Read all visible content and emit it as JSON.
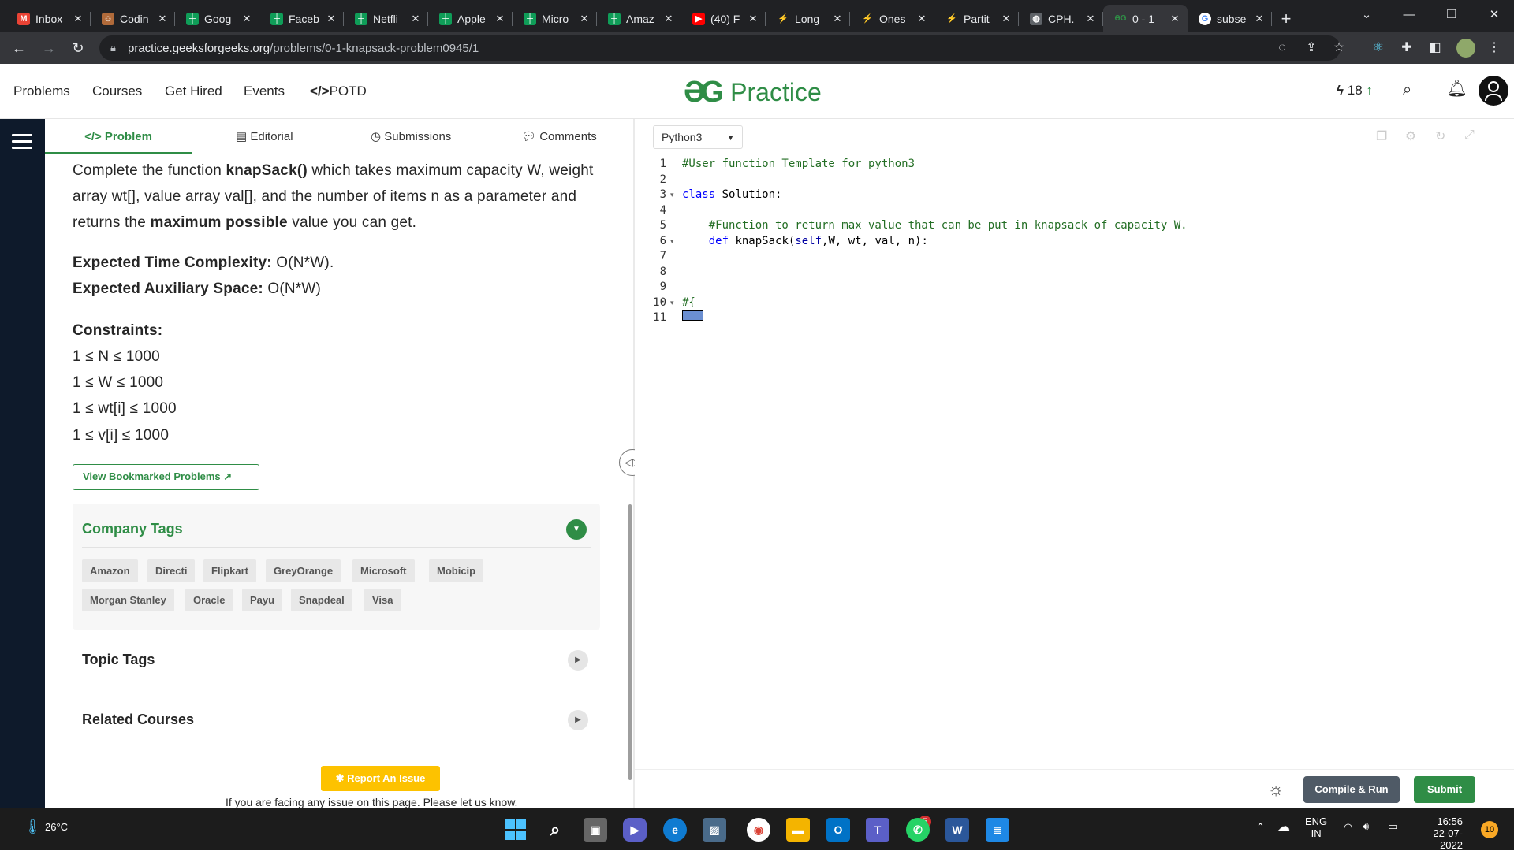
{
  "browser": {
    "tabs": [
      {
        "title": "Inbox",
        "favicon": "gmail-icon",
        "color": "#ea4335",
        "glyph": "M"
      },
      {
        "title": "Codin",
        "favicon": "avatar-icon",
        "color": "#b06a3a",
        "glyph": "☺"
      },
      {
        "title": "Goog",
        "favicon": "gfg-doc-icon",
        "color": "#0f9d58",
        "glyph": "┼"
      },
      {
        "title": "Faceb",
        "favicon": "gfg-doc-icon",
        "color": "#0f9d58",
        "glyph": "┼"
      },
      {
        "title": "Netfli",
        "favicon": "gfg-doc-icon",
        "color": "#0f9d58",
        "glyph": "┼"
      },
      {
        "title": "Apple",
        "favicon": "gfg-doc-icon",
        "color": "#0f9d58",
        "glyph": "┼"
      },
      {
        "title": "Micro",
        "favicon": "gfg-doc-icon",
        "color": "#0f9d58",
        "glyph": "┼"
      },
      {
        "title": "Amaz",
        "favicon": "gfg-doc-icon",
        "color": "#0f9d58",
        "glyph": "┼"
      },
      {
        "title": "(40) F",
        "favicon": "youtube-icon",
        "color": "#ff0000",
        "glyph": "▶"
      },
      {
        "title": "Long",
        "favicon": "leetcode-icon",
        "color": "#202124",
        "glyph": "⚡"
      },
      {
        "title": "Ones",
        "favicon": "leetcode-icon",
        "color": "#202124",
        "glyph": "⚡"
      },
      {
        "title": "Partit",
        "favicon": "leetcode-icon",
        "color": "#202124",
        "glyph": "⚡"
      },
      {
        "title": "CPH.",
        "favicon": "globe-icon",
        "color": "#5f6368",
        "glyph": "◍"
      },
      {
        "title": "0 - 1",
        "favicon": "gfg-icon",
        "color": "#35363a",
        "glyph": "ƏG",
        "active": true
      },
      {
        "title": "subse",
        "favicon": "google-icon",
        "color": "#ffffff",
        "glyph": "G"
      }
    ],
    "url_host": "practice.geeksforgeeks.org",
    "url_path": "/problems/0-1-knapsack-problem0945/1"
  },
  "header": {
    "nav": [
      "Problems",
      "Courses",
      "Get Hired",
      "Events",
      "POTD"
    ],
    "potd_prefix": "</>",
    "logo_mark": "ƏG",
    "logo_text": "Practice",
    "streak": "18"
  },
  "problem_tabs": [
    "Problem",
    "Editorial",
    "Submissions",
    "Comments"
  ],
  "problem": {
    "desc_1a": "Complete the function ",
    "desc_1b": "knapSack()",
    "desc_1c": " which takes maximum capacity W, weight",
    "desc_2": "array wt[], value array val[], and the number of items n as a parameter and",
    "desc_3a": "returns the ",
    "desc_3b": "maximum possible",
    "desc_3c": " value you can get.",
    "time_label": "Expected Time Complexity:",
    "time_value": " O(N*W).",
    "space_label": "Expected Auxiliary Space:",
    "space_value": " O(N*W)",
    "constraints_label": "Constraints:",
    "constraints": [
      "1 ≤ N ≤ 1000",
      "1 ≤ W ≤ 1000",
      "1 ≤ wt[i] ≤ 1000",
      "1 ≤ v[i] ≤ 1000"
    ],
    "bookmark_button": "View Bookmarked Problems",
    "company_tags_label": "Company Tags",
    "company_tags_row1": [
      "Amazon",
      "Directi",
      "Flipkart",
      "GreyOrange",
      "Microsoft",
      "Mobicip"
    ],
    "company_tags_row2": [
      "Morgan Stanley",
      "Oracle",
      "Payu",
      "Snapdeal",
      "Visa"
    ],
    "topic_tags_label": "Topic Tags",
    "related_courses_label": "Related Courses",
    "report_button": "Report An Issue",
    "report_note": "If you are facing any issue on this page. Please let us know."
  },
  "editor": {
    "language": "Python3",
    "lines": [
      {
        "n": "1",
        "text": "#User function Template for python3",
        "cls": "cm",
        "fold": ""
      },
      {
        "n": "2",
        "text": "",
        "cls": "",
        "fold": ""
      },
      {
        "n": "3",
        "text": "class Solution:",
        "cls": "",
        "fold": "▾"
      },
      {
        "n": "4",
        "text": "",
        "cls": "",
        "fold": ""
      },
      {
        "n": "5",
        "text": "    #Function to return max value that can be put in knapsack of capacity W.",
        "cls": "cm",
        "fold": ""
      },
      {
        "n": "6",
        "text": "    def knapSack(self,W, wt, val, n):",
        "cls": "",
        "fold": "▾"
      },
      {
        "n": "7",
        "text": "",
        "cls": "",
        "fold": ""
      },
      {
        "n": "8",
        "text": "",
        "cls": "",
        "fold": ""
      },
      {
        "n": "9",
        "text": "",
        "cls": "",
        "fold": ""
      },
      {
        "n": "10",
        "text": "#{",
        "cls": "cm",
        "fold": "▾"
      },
      {
        "n": "11",
        "text": "",
        "cls": "",
        "fold": ""
      }
    ],
    "compile_button": "Compile & Run",
    "submit_button": "Submit"
  },
  "taskbar": {
    "weather": "26°C",
    "lang_top": "ENG",
    "lang_bottom": "IN",
    "time": "16:56",
    "date": "22-07-2022",
    "notif_count": "10",
    "teams_badge": "5"
  },
  "colors": {
    "brand_green": "#2f8d46",
    "report_yellow": "#fdc200",
    "sidebar_dark": "#0e1a2b"
  }
}
